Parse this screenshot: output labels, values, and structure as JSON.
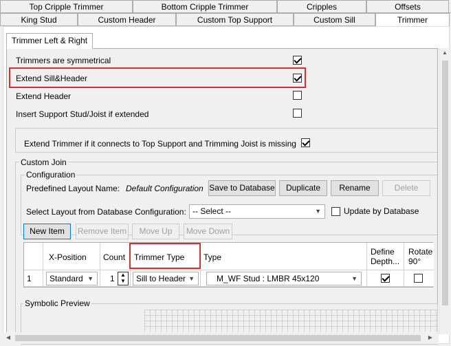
{
  "tabs_row1": [
    "Top Cripple Trimmer",
    "Bottom Cripple Trimmer",
    "Cripples",
    "Offsets"
  ],
  "tabs_row2": [
    "King Stud",
    "Custom Header",
    "Custom Top Support",
    "Custom Sill",
    "Trimmer"
  ],
  "active_tab": "Trimmer",
  "subtab": "Trimmer Left & Right",
  "options": [
    {
      "label": "Trimmers are symmetrical",
      "checked": true
    },
    {
      "label": "Extend Sill&Header",
      "checked": true
    },
    {
      "label": "Extend Header",
      "checked": false
    },
    {
      "label": "Insert Support Stud/Joist if extended",
      "checked": false
    }
  ],
  "extend_trimmer": {
    "label": "Extend Trimmer if it connects to Top Support and Trimming Joist is missing",
    "checked": true
  },
  "custom_join": {
    "title": "Custom Join",
    "configuration_title": "Configuration",
    "layout_name_label": "Predefined Layout Name:",
    "layout_name_value": "Default Configuration",
    "buttons": {
      "save": "Save to Database",
      "duplicate": "Duplicate",
      "rename": "Rename",
      "delete": "Delete"
    },
    "select_label": "Select Layout from Database Configuration:",
    "select_value": "-- Select --",
    "update_by_db": {
      "label": "Update by Database",
      "checked": false
    },
    "item_buttons": {
      "new": "New Item",
      "remove": "Remove Item",
      "up": "Move Up",
      "down": "Move Down"
    }
  },
  "grid": {
    "columns": [
      "X-Position",
      "Count",
      "Trimmer Type",
      "Type",
      "Define Depth...",
      "Rotate 90°"
    ],
    "rows": [
      {
        "index": "1",
        "x_position": "Standard",
        "count": "1",
        "trimmer_type": "Sill to Header",
        "type": "M_WF Stud : LMBR 45x120",
        "define_depth": true,
        "rotate": false
      }
    ]
  },
  "symbolic_preview": "Symbolic Preview",
  "colors": {
    "highlight": "#d32f2f",
    "focus": "#0078d7"
  }
}
